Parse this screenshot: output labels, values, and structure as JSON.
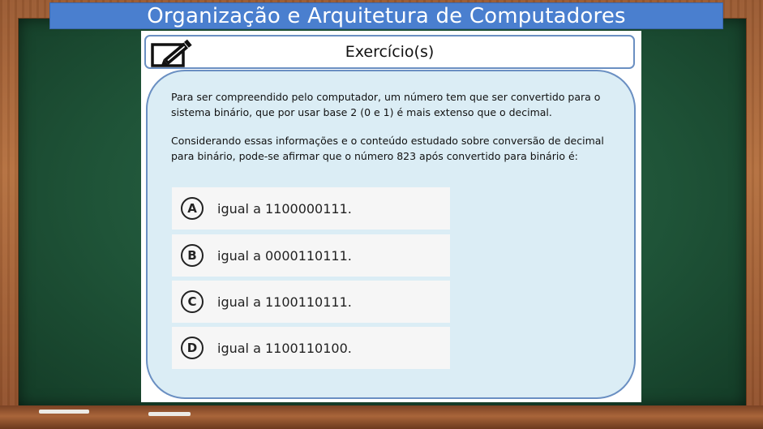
{
  "title": "Organização e Arquitetura de Computadores",
  "header": {
    "icon": "edit-pencil-icon",
    "title": "Exercício(s)"
  },
  "question": {
    "paragraph_1": "Para ser compreendido pelo computador, um número tem que ser convertido para o sistema binário, que por usar base 2 (0 e 1) é mais extenso que o decimal.",
    "paragraph_2": "Considerando essas informações e o conteúdo estudado sobre conversão de decimal para binário, pode-se afirmar que o número 823 após convertido para binário é:"
  },
  "options": [
    {
      "letter": "A",
      "text": "igual a 1100000111."
    },
    {
      "letter": "B",
      "text": "igual a 0000110111."
    },
    {
      "letter": "C",
      "text": "igual a 1100110111."
    },
    {
      "letter": "D",
      "text": "igual a 1100110100."
    }
  ],
  "colors": {
    "title_bar": "#4a7fcf",
    "board": "#1f5438",
    "frame": "#a9653a",
    "content_box": "#dbedf5",
    "border": "#6a8fc2"
  }
}
